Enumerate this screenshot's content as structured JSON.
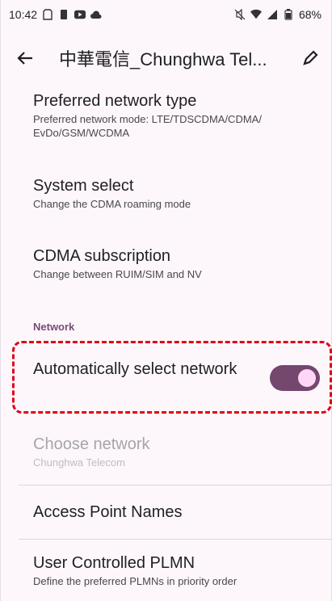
{
  "status_bar": {
    "time": "10:42",
    "battery": "68%",
    "icons_left": [
      "sim-icon",
      "person-icon",
      "youtube-icon",
      "cloud-icon"
    ],
    "icons_right": [
      "mute-icon",
      "wifi-icon",
      "signal-icon",
      "battery-icon"
    ]
  },
  "app_bar": {
    "title": "中華電信_Chunghwa Tel..."
  },
  "settings": [
    {
      "title": "Preferred network type",
      "subtitle": "Preferred network mode: LTE/TDSCDMA/CDMA/ EvDo/GSM/WCDMA"
    },
    {
      "title": "System select",
      "subtitle": "Change the CDMA roaming mode"
    },
    {
      "title": "CDMA subscription",
      "subtitle": "Change between RUIM/SIM and NV"
    }
  ],
  "section_network": "Network",
  "auto_select": {
    "title": "Automatically select network",
    "enabled": true
  },
  "choose_network": {
    "title": "Choose network",
    "subtitle": "Chunghwa Telecom"
  },
  "apn": {
    "title": "Access Point Names"
  },
  "plmn": {
    "title": "User Controlled PLMN",
    "subtitle": "Define the preferred PLMNs in priority order"
  },
  "colors": {
    "accent": "#74476f",
    "highlight": "#e0001b",
    "background": "#fdf7fb"
  }
}
